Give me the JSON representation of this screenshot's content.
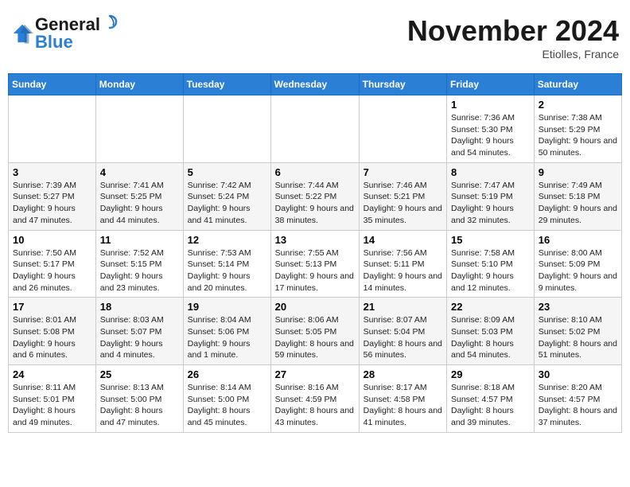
{
  "header": {
    "logo_line1": "General",
    "logo_line2": "Blue",
    "month_title": "November 2024",
    "location": "Etiolles, France"
  },
  "weekdays": [
    "Sunday",
    "Monday",
    "Tuesday",
    "Wednesday",
    "Thursday",
    "Friday",
    "Saturday"
  ],
  "weeks": [
    [
      {
        "day": "",
        "info": ""
      },
      {
        "day": "",
        "info": ""
      },
      {
        "day": "",
        "info": ""
      },
      {
        "day": "",
        "info": ""
      },
      {
        "day": "",
        "info": ""
      },
      {
        "day": "1",
        "info": "Sunrise: 7:36 AM\nSunset: 5:30 PM\nDaylight: 9 hours and 54 minutes."
      },
      {
        "day": "2",
        "info": "Sunrise: 7:38 AM\nSunset: 5:29 PM\nDaylight: 9 hours and 50 minutes."
      }
    ],
    [
      {
        "day": "3",
        "info": "Sunrise: 7:39 AM\nSunset: 5:27 PM\nDaylight: 9 hours and 47 minutes."
      },
      {
        "day": "4",
        "info": "Sunrise: 7:41 AM\nSunset: 5:25 PM\nDaylight: 9 hours and 44 minutes."
      },
      {
        "day": "5",
        "info": "Sunrise: 7:42 AM\nSunset: 5:24 PM\nDaylight: 9 hours and 41 minutes."
      },
      {
        "day": "6",
        "info": "Sunrise: 7:44 AM\nSunset: 5:22 PM\nDaylight: 9 hours and 38 minutes."
      },
      {
        "day": "7",
        "info": "Sunrise: 7:46 AM\nSunset: 5:21 PM\nDaylight: 9 hours and 35 minutes."
      },
      {
        "day": "8",
        "info": "Sunrise: 7:47 AM\nSunset: 5:19 PM\nDaylight: 9 hours and 32 minutes."
      },
      {
        "day": "9",
        "info": "Sunrise: 7:49 AM\nSunset: 5:18 PM\nDaylight: 9 hours and 29 minutes."
      }
    ],
    [
      {
        "day": "10",
        "info": "Sunrise: 7:50 AM\nSunset: 5:17 PM\nDaylight: 9 hours and 26 minutes."
      },
      {
        "day": "11",
        "info": "Sunrise: 7:52 AM\nSunset: 5:15 PM\nDaylight: 9 hours and 23 minutes."
      },
      {
        "day": "12",
        "info": "Sunrise: 7:53 AM\nSunset: 5:14 PM\nDaylight: 9 hours and 20 minutes."
      },
      {
        "day": "13",
        "info": "Sunrise: 7:55 AM\nSunset: 5:13 PM\nDaylight: 9 hours and 17 minutes."
      },
      {
        "day": "14",
        "info": "Sunrise: 7:56 AM\nSunset: 5:11 PM\nDaylight: 9 hours and 14 minutes."
      },
      {
        "day": "15",
        "info": "Sunrise: 7:58 AM\nSunset: 5:10 PM\nDaylight: 9 hours and 12 minutes."
      },
      {
        "day": "16",
        "info": "Sunrise: 8:00 AM\nSunset: 5:09 PM\nDaylight: 9 hours and 9 minutes."
      }
    ],
    [
      {
        "day": "17",
        "info": "Sunrise: 8:01 AM\nSunset: 5:08 PM\nDaylight: 9 hours and 6 minutes."
      },
      {
        "day": "18",
        "info": "Sunrise: 8:03 AM\nSunset: 5:07 PM\nDaylight: 9 hours and 4 minutes."
      },
      {
        "day": "19",
        "info": "Sunrise: 8:04 AM\nSunset: 5:06 PM\nDaylight: 9 hours and 1 minute."
      },
      {
        "day": "20",
        "info": "Sunrise: 8:06 AM\nSunset: 5:05 PM\nDaylight: 8 hours and 59 minutes."
      },
      {
        "day": "21",
        "info": "Sunrise: 8:07 AM\nSunset: 5:04 PM\nDaylight: 8 hours and 56 minutes."
      },
      {
        "day": "22",
        "info": "Sunrise: 8:09 AM\nSunset: 5:03 PM\nDaylight: 8 hours and 54 minutes."
      },
      {
        "day": "23",
        "info": "Sunrise: 8:10 AM\nSunset: 5:02 PM\nDaylight: 8 hours and 51 minutes."
      }
    ],
    [
      {
        "day": "24",
        "info": "Sunrise: 8:11 AM\nSunset: 5:01 PM\nDaylight: 8 hours and 49 minutes."
      },
      {
        "day": "25",
        "info": "Sunrise: 8:13 AM\nSunset: 5:00 PM\nDaylight: 8 hours and 47 minutes."
      },
      {
        "day": "26",
        "info": "Sunrise: 8:14 AM\nSunset: 5:00 PM\nDaylight: 8 hours and 45 minutes."
      },
      {
        "day": "27",
        "info": "Sunrise: 8:16 AM\nSunset: 4:59 PM\nDaylight: 8 hours and 43 minutes."
      },
      {
        "day": "28",
        "info": "Sunrise: 8:17 AM\nSunset: 4:58 PM\nDaylight: 8 hours and 41 minutes."
      },
      {
        "day": "29",
        "info": "Sunrise: 8:18 AM\nSunset: 4:57 PM\nDaylight: 8 hours and 39 minutes."
      },
      {
        "day": "30",
        "info": "Sunrise: 8:20 AM\nSunset: 4:57 PM\nDaylight: 8 hours and 37 minutes."
      }
    ]
  ]
}
